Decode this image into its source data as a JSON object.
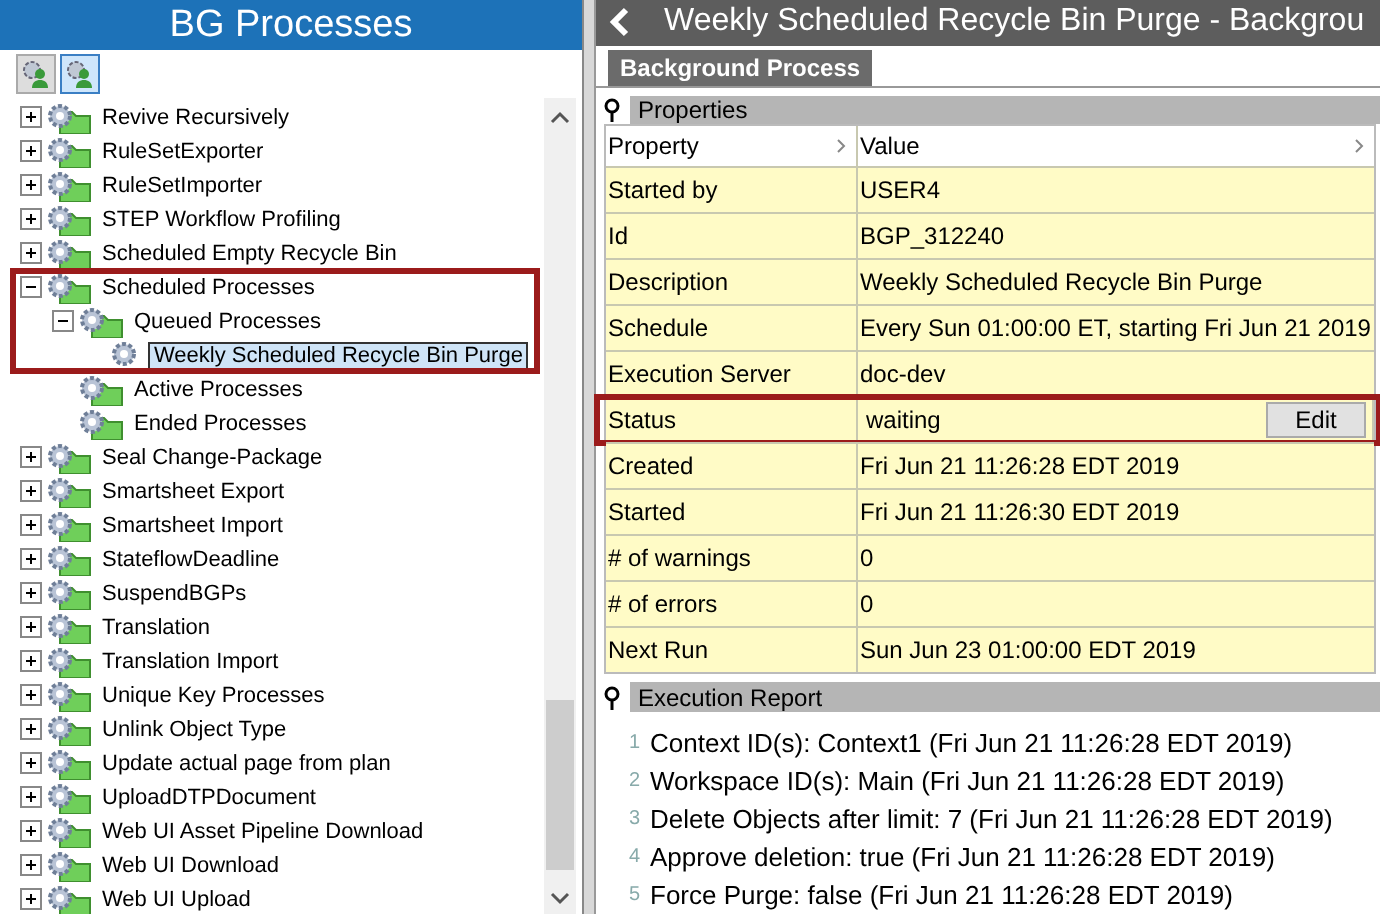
{
  "left_panel": {
    "title": "BG Processes",
    "toolbar": [
      {
        "selected": false
      },
      {
        "selected": true
      }
    ],
    "tree": [
      {
        "label": "Revive Recursively",
        "kind": "group",
        "expanded": false,
        "selected": false,
        "highlighted": false
      },
      {
        "label": "RuleSetExporter",
        "kind": "group",
        "expanded": false,
        "selected": false,
        "highlighted": false
      },
      {
        "label": "RuleSetImporter",
        "kind": "group",
        "expanded": false,
        "selected": false,
        "highlighted": false
      },
      {
        "label": "STEP Workflow Profiling",
        "kind": "group",
        "expanded": false,
        "selected": false,
        "highlighted": false
      },
      {
        "label": "Scheduled Empty Recycle Bin",
        "kind": "group",
        "expanded": false,
        "selected": false,
        "highlighted": false
      },
      {
        "label": "Scheduled Processes",
        "kind": "group",
        "expanded": true,
        "selected": false,
        "highlighted": true,
        "children": [
          {
            "label": "Queued Processes",
            "kind": "group",
            "expanded": true,
            "selected": false,
            "highlighted": true,
            "children": [
              {
                "label": "Weekly Scheduled Recycle Bin Purge",
                "kind": "process",
                "selected": true,
                "highlighted": true
              }
            ]
          },
          {
            "label": "Active Processes",
            "kind": "leaf",
            "selected": false,
            "highlighted": false
          },
          {
            "label": "Ended Processes",
            "kind": "leaf",
            "selected": false,
            "highlighted": false
          }
        ]
      },
      {
        "label": "Seal Change-Package",
        "kind": "group",
        "expanded": false,
        "selected": false,
        "highlighted": false
      },
      {
        "label": "Smartsheet Export",
        "kind": "group",
        "expanded": false,
        "selected": false,
        "highlighted": false
      },
      {
        "label": "Smartsheet Import",
        "kind": "group",
        "expanded": false,
        "selected": false,
        "highlighted": false
      },
      {
        "label": "StateflowDeadline",
        "kind": "group",
        "expanded": false,
        "selected": false,
        "highlighted": false
      },
      {
        "label": "SuspendBGPs",
        "kind": "group",
        "expanded": false,
        "selected": false,
        "highlighted": false
      },
      {
        "label": "Translation",
        "kind": "group",
        "expanded": false,
        "selected": false,
        "highlighted": false
      },
      {
        "label": "Translation Import",
        "kind": "group",
        "expanded": false,
        "selected": false,
        "highlighted": false
      },
      {
        "label": "Unique Key Processes",
        "kind": "group",
        "expanded": false,
        "selected": false,
        "highlighted": false
      },
      {
        "label": "Unlink Object Type",
        "kind": "group",
        "expanded": false,
        "selected": false,
        "highlighted": false
      },
      {
        "label": "Update actual page from plan",
        "kind": "group",
        "expanded": false,
        "selected": false,
        "highlighted": false
      },
      {
        "label": "UploadDTPDocument",
        "kind": "group",
        "expanded": false,
        "selected": false,
        "highlighted": false
      },
      {
        "label": "Web UI Asset Pipeline Download",
        "kind": "group",
        "expanded": false,
        "selected": false,
        "highlighted": false
      },
      {
        "label": "Web UI Download",
        "kind": "group",
        "expanded": false,
        "selected": false,
        "highlighted": false
      },
      {
        "label": "Web UI Upload",
        "kind": "group",
        "expanded": false,
        "selected": false,
        "highlighted": false
      }
    ]
  },
  "detail": {
    "title": "Weekly Scheduled Recycle Bin Purge - Backgrou",
    "tabs": [
      {
        "label": "Background Process",
        "selected": true
      }
    ],
    "properties": {
      "title": "Properties",
      "columns": [
        "Property",
        "Value"
      ],
      "rows": [
        {
          "property": "Started by",
          "value": "USER4",
          "highlighted": false
        },
        {
          "property": "Id",
          "value": "BGP_312240",
          "highlighted": false
        },
        {
          "property": "Description",
          "value": "Weekly Scheduled Recycle Bin Purge",
          "highlighted": false
        },
        {
          "property": "Schedule",
          "value": "Every Sun 01:00:00 ET, starting Fri Jun 21 2019",
          "highlighted": false
        },
        {
          "property": "Execution Server",
          "value": "doc-dev",
          "highlighted": false
        },
        {
          "property": "Status",
          "value": "waiting",
          "button": "Edit",
          "highlighted": true
        },
        {
          "property": "Created",
          "value": "Fri Jun 21 11:26:28 EDT 2019",
          "highlighted": false
        },
        {
          "property": "Started",
          "value": "Fri Jun 21 11:26:30 EDT 2019",
          "highlighted": false
        },
        {
          "property": "# of warnings",
          "value": "0",
          "highlighted": false
        },
        {
          "property": "# of errors",
          "value": "0",
          "highlighted": false
        },
        {
          "property": "Next Run",
          "value": "Sun Jun 23 01:00:00 EDT 2019",
          "highlighted": false
        }
      ]
    },
    "report": {
      "title": "Execution Report",
      "lines": [
        {
          "number": "1",
          "text": "Context ID(s): Context1 (Fri Jun 21 11:26:28 EDT 2019)"
        },
        {
          "number": "2",
          "text": "Workspace ID(s): Main (Fri Jun 21 11:26:28 EDT 2019)"
        },
        {
          "number": "3",
          "text": "Delete Objects after limit: 7 (Fri Jun 21 11:26:28 EDT 2019)"
        },
        {
          "number": "4",
          "text": "Approve deletion: true (Fri Jun 21 11:26:28 EDT 2019)"
        },
        {
          "number": "5",
          "text": "Force Purge: false (Fri Jun 21 11:26:28 EDT 2019)"
        }
      ]
    }
  }
}
